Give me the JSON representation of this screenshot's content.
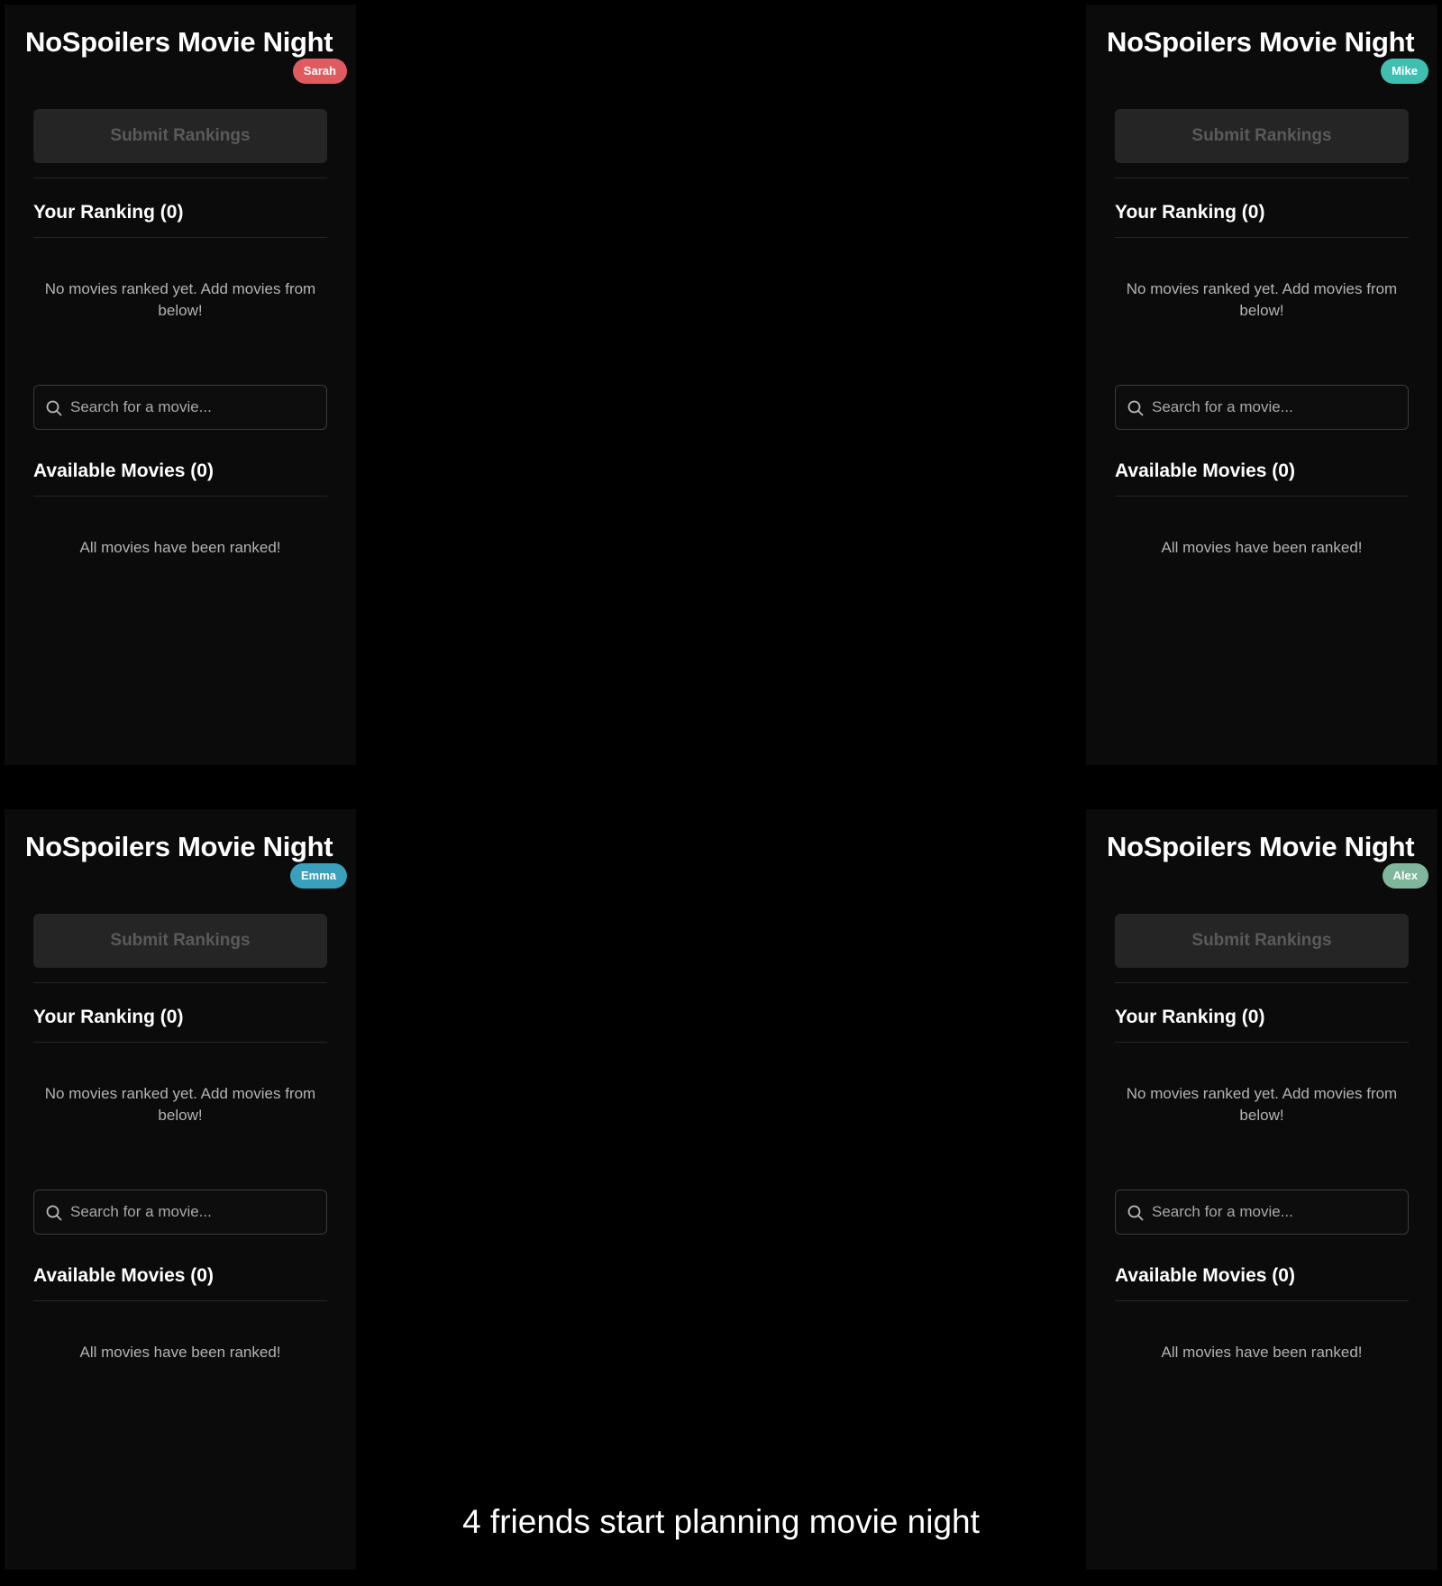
{
  "caption": "4 friends start planning movie night",
  "panels": [
    {
      "app_title": "NoSpoilers Movie Night",
      "user": {
        "name": "Sarah",
        "color": "#e05b60"
      },
      "submit_label": "Submit Rankings",
      "ranking_heading": "Your Ranking (0)",
      "ranking_empty": "No movies ranked yet. Add movies from below!",
      "search": {
        "placeholder": "Search for a movie...",
        "icon": "search-icon"
      },
      "available_heading": "Available Movies (0)",
      "available_empty": "All movies have been ranked!"
    },
    {
      "app_title": "NoSpoilers Movie Night",
      "user": {
        "name": "Mike",
        "color": "#3fbfb2"
      },
      "submit_label": "Submit Rankings",
      "ranking_heading": "Your Ranking (0)",
      "ranking_empty": "No movies ranked yet. Add movies from below!",
      "search": {
        "placeholder": "Search for a movie...",
        "icon": "search-icon"
      },
      "available_heading": "Available Movies (0)",
      "available_empty": "All movies have been ranked!"
    },
    {
      "app_title": "NoSpoilers Movie Night",
      "user": {
        "name": "Emma",
        "color": "#3aa1bd"
      },
      "submit_label": "Submit Rankings",
      "ranking_heading": "Your Ranking (0)",
      "ranking_empty": "No movies ranked yet. Add movies from below!",
      "search": {
        "placeholder": "Search for a movie...",
        "icon": "search-icon"
      },
      "available_heading": "Available Movies (0)",
      "available_empty": "All movies have been ranked!"
    },
    {
      "app_title": "NoSpoilers Movie Night",
      "user": {
        "name": "Alex",
        "color": "#7fb69c"
      },
      "submit_label": "Submit Rankings",
      "ranking_heading": "Your Ranking (0)",
      "ranking_empty": "No movies ranked yet. Add movies from below!",
      "search": {
        "placeholder": "Search for a movie...",
        "icon": "search-icon"
      },
      "available_heading": "Available Movies (0)",
      "available_empty": "All movies have been ranked!"
    }
  ]
}
